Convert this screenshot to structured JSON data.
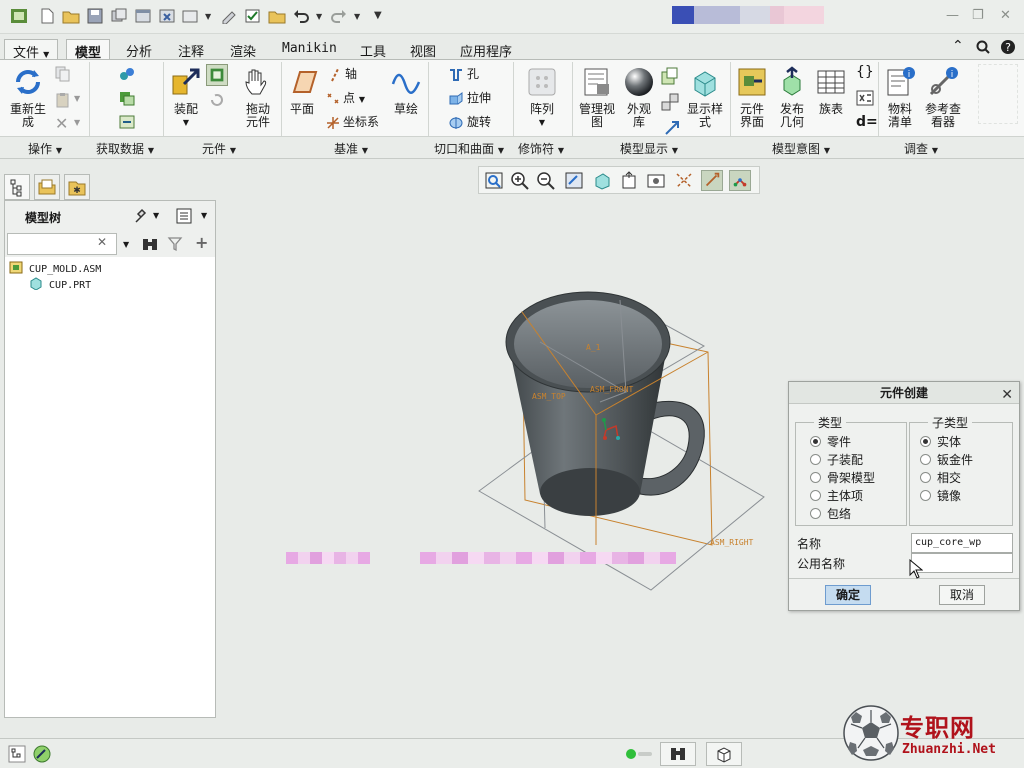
{
  "tabs": {
    "file": "文件",
    "items": [
      "模型",
      "分析",
      "注释",
      "渲染",
      "Manikin",
      "工具",
      "视图",
      "应用程序"
    ]
  },
  "ribbon": {
    "buttons": {
      "regenerate": "重新生\n成",
      "assemble": "装配",
      "drag": "拖动\n元件",
      "plane": "平面",
      "axis": "轴",
      "point": "点",
      "csys": "坐标系",
      "sketch": "草绘",
      "hole": "孔",
      "extrude": "拉伸",
      "revolve": "旋转",
      "pattern": "阵列",
      "manage_views": "管理视\n图",
      "appearance": "外观\n库",
      "display_style": "显示样\n式",
      "component_interface": "元件\n界面",
      "publish_geometry": "发布\n几何",
      "family_table": "族表",
      "bom": "物料\n清单",
      "reference_viewer": "参考查\n看器"
    },
    "groups": [
      "操作",
      "获取数据",
      "元件",
      "基准",
      "切口和曲面",
      "修饰符",
      "模型显示",
      "模型意图",
      "调查"
    ]
  },
  "navigator": {
    "title": "模型树",
    "search_value": "",
    "items": [
      "CUP_MOLD.ASM",
      "CUP.PRT"
    ]
  },
  "canvas": {
    "datum_labels": [
      "ASM_TOP",
      "ASM_FRONT",
      "ASM_RIGHT",
      "A_1"
    ]
  },
  "dialog": {
    "title": "元件创建",
    "type_legend": "类型",
    "types": [
      "零件",
      "子装配",
      "骨架模型",
      "主体项",
      "包络"
    ],
    "subtype_legend": "子类型",
    "subtypes": [
      "实体",
      "钣金件",
      "相交",
      "镜像"
    ],
    "name_label": "名称",
    "name_value": "cup_core_wp",
    "common_name_label": "公用名称",
    "common_name_value": "",
    "ok": "确定",
    "cancel": "取消"
  },
  "watermark": {
    "cn": "专职网",
    "en": "Zhuanzhi.Net"
  },
  "colors": {
    "accent": "#6e9ccf",
    "active_tab": "#f7f8f7",
    "watermark": "#b0121b"
  }
}
